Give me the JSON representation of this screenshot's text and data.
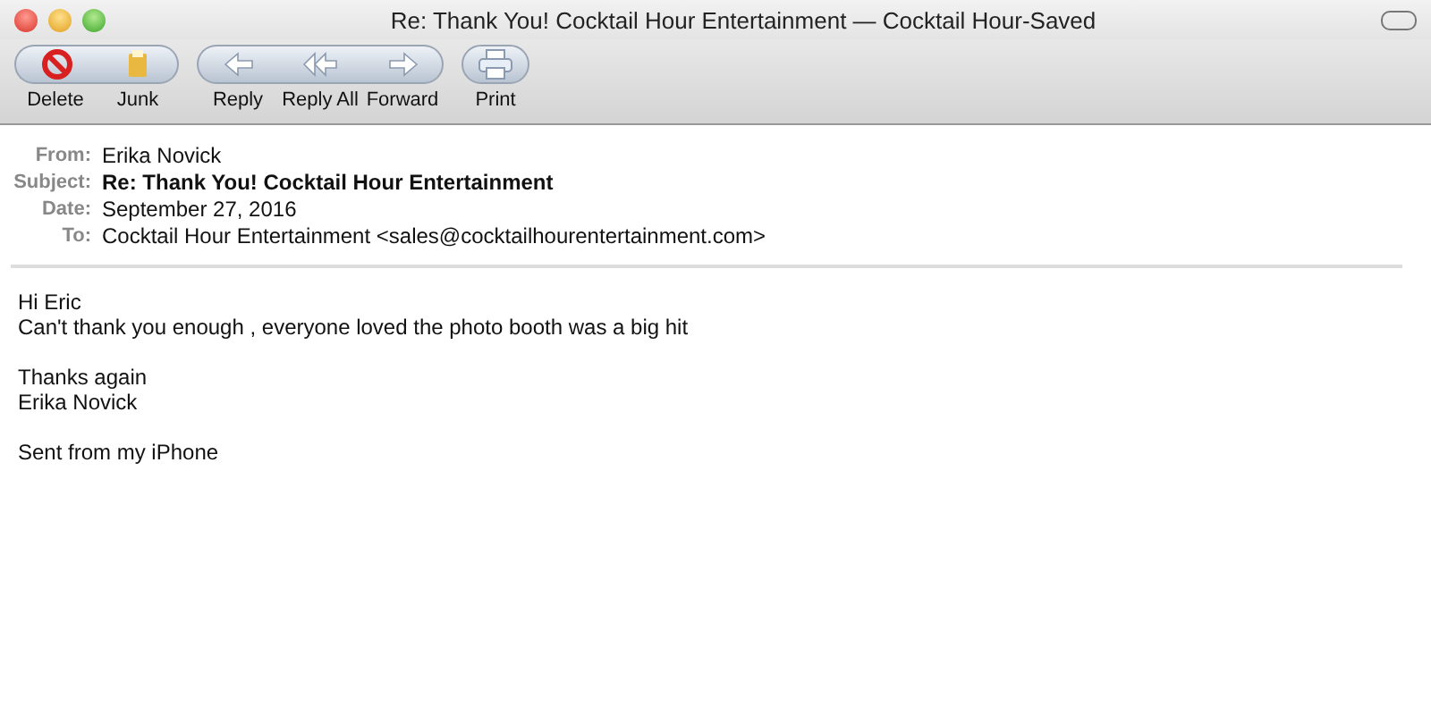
{
  "window": {
    "title": "Re: Thank You! Cocktail Hour Entertainment — Cocktail Hour-Saved"
  },
  "toolbar": {
    "groups": [
      {
        "buttons": [
          {
            "label": "Delete"
          },
          {
            "label": "Junk"
          }
        ]
      },
      {
        "buttons": [
          {
            "label": "Reply"
          },
          {
            "label": "Reply All"
          },
          {
            "label": "Forward"
          }
        ]
      },
      {
        "buttons": [
          {
            "label": "Print"
          }
        ]
      }
    ]
  },
  "headers": [
    {
      "label": "From:",
      "value": "Erika Novick",
      "bold": false
    },
    {
      "label": "Subject:",
      "value": "Re: Thank You! Cocktail Hour Entertainment",
      "bold": true
    },
    {
      "label": "Date:",
      "value": "September 27, 2016",
      "bold": false
    },
    {
      "label": "To:",
      "value": "Cocktail Hour Entertainment <sales@cocktailhourentertainment.com>",
      "bold": false
    }
  ],
  "body": [
    [
      "Hi Eric",
      "Can't thank you enough , everyone loved the photo booth was a big hit"
    ],
    [
      "Thanks again",
      "Erika Novick"
    ],
    [
      "Sent from my iPhone"
    ]
  ]
}
